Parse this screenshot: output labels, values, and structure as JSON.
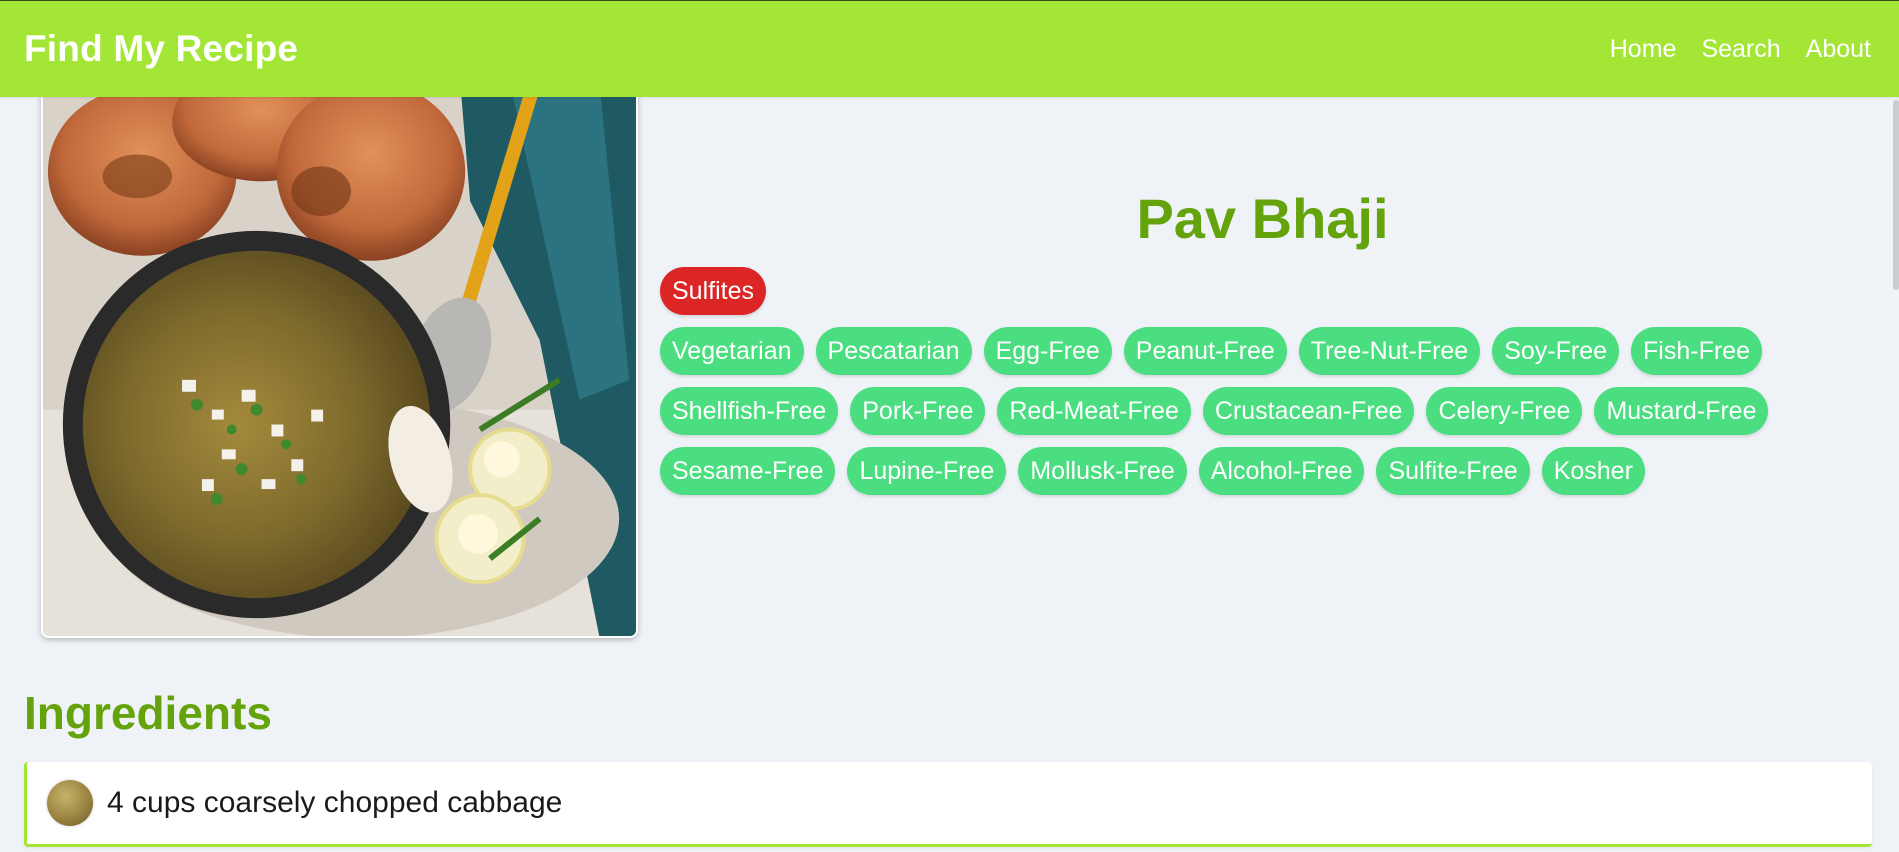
{
  "header": {
    "brand": "Find My Recipe",
    "nav": [
      {
        "label": "Home"
      },
      {
        "label": "Search"
      },
      {
        "label": "About"
      }
    ]
  },
  "recipe": {
    "title": "Pav Bhaji",
    "warnings": [
      "Sulfites"
    ],
    "health_labels": [
      [
        "Vegetarian",
        "Pescatarian",
        "Egg-Free",
        "Peanut-Free",
        "Tree-Nut-Free",
        "Soy-Free",
        "Fish-Free"
      ],
      [
        "Shellfish-Free",
        "Pork-Free",
        "Red-Meat-Free",
        "Crustacean-Free",
        "Celery-Free",
        "Mustard-Free"
      ],
      [
        "Sesame-Free",
        "Lupine-Free",
        "Mollusk-Free",
        "Alcohol-Free",
        "Sulfite-Free",
        "Kosher"
      ]
    ]
  },
  "ingredients": {
    "heading": "Ingredients",
    "items": [
      {
        "text": "4 cups coarsely chopped cabbage"
      }
    ]
  },
  "colors": {
    "brand": "#a3e635",
    "accent_text": "#65a30d",
    "warning_tag": "#dc2626",
    "label_tag": "#4ade80",
    "background": "#eff3f8"
  }
}
